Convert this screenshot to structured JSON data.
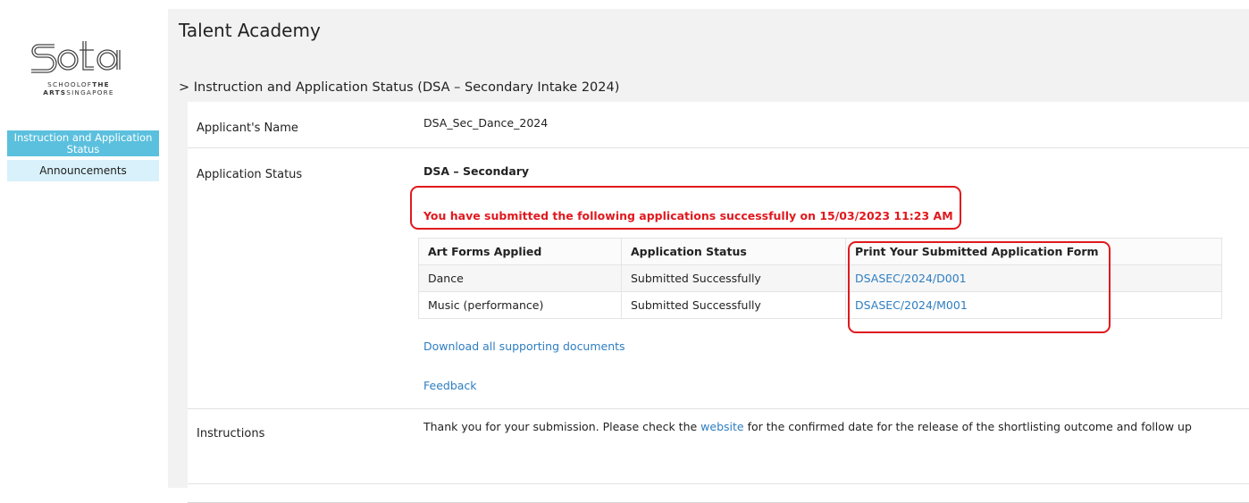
{
  "logo": {
    "mark": "sota",
    "line1_a": "SCHOOLOF",
    "line1_b": "THE",
    "line2_a": "ARTS",
    "line2_b": "SINGAPORE"
  },
  "sidebar": {
    "items": [
      {
        "label": "Instruction and Application Status",
        "active": true
      },
      {
        "label": "Announcements",
        "active": false
      }
    ]
  },
  "header": {
    "title": "Talent Academy"
  },
  "breadcrumb": "> Instruction and Application Status (DSA – Secondary Intake 2024)",
  "applicant": {
    "label": "Applicant's Name",
    "value": "DSA_Sec_Dance_2024"
  },
  "status": {
    "label": "Application Status",
    "programme": "DSA – Secondary",
    "message": "You have submitted the following applications successfully on 15/03/2023 11:23 AM"
  },
  "table": {
    "headers": [
      "Art Forms Applied",
      "Application Status",
      "Print Your Submitted Application Form"
    ],
    "rows": [
      {
        "art_form": "Dance",
        "status": "Submitted Successfully",
        "form_link": "DSASEC/2024/D001"
      },
      {
        "art_form": "Music (performance)",
        "status": "Submitted Successfully",
        "form_link": "DSASEC/2024/M001"
      }
    ]
  },
  "links": {
    "download": "Download all supporting documents",
    "feedback": "Feedback"
  },
  "instructions": {
    "label": "Instructions",
    "text_before": "Thank you for your submission. Please check the ",
    "link": "website",
    "text_after": " for the confirmed date for the release of the shortlisting outcome and follow up"
  },
  "colors": {
    "accent": "#5bc0de",
    "nav_light": "#d8f1fa",
    "error": "#e0191e",
    "link": "#2e7ec2"
  }
}
